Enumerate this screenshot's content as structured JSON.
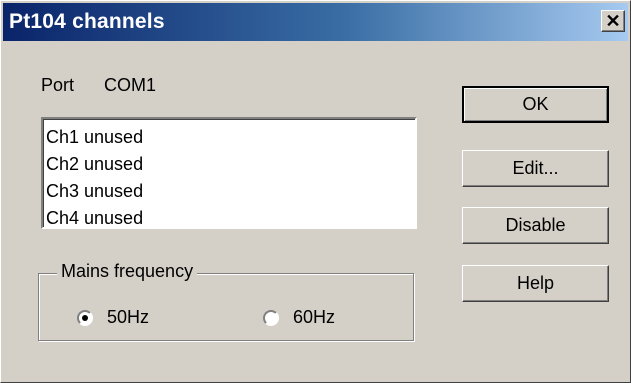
{
  "window": {
    "title": "Pt104 channels",
    "close_glyph": "✕",
    "colors": {
      "title_start": "#0a246a",
      "title_end": "#a6caf0",
      "face": "#d4d0c8"
    }
  },
  "port": {
    "label": "Port",
    "value": "COM1"
  },
  "channels": [
    {
      "label": "Ch1 unused"
    },
    {
      "label": "Ch2 unused"
    },
    {
      "label": "Ch3 unused"
    },
    {
      "label": "Ch4 unused"
    }
  ],
  "mains": {
    "label": "Mains frequency",
    "options": [
      {
        "label": "50Hz",
        "checked": true
      },
      {
        "label": "60Hz",
        "checked": false
      }
    ]
  },
  "buttons": {
    "ok": "OK",
    "edit": "Edit...",
    "disable": "Disable",
    "help": "Help"
  }
}
